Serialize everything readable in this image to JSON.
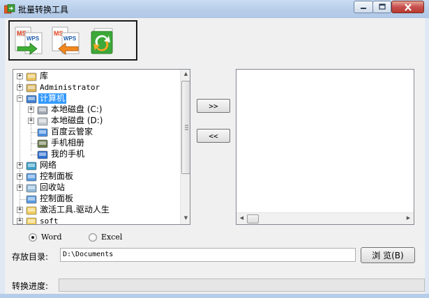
{
  "window": {
    "title": "批量转换工具",
    "controls": {
      "minimize": "–",
      "maximize": "□",
      "close": "✕"
    }
  },
  "toolbar": {
    "buttons": [
      {
        "name": "ms-to-wps",
        "label_top": "MS",
        "label_bottom": "WPS"
      },
      {
        "name": "wps-to-ms",
        "label_top": "MS",
        "label_bottom": "WPS"
      },
      {
        "name": "refresh"
      }
    ]
  },
  "tree": {
    "items": [
      {
        "label": "库",
        "icon": "library-icon",
        "expander": "+"
      },
      {
        "label": "Administrator",
        "icon": "user-folder-icon",
        "expander": "+"
      },
      {
        "label": "计算机",
        "icon": "computer-icon",
        "expander": "−",
        "selected": true
      },
      {
        "label": "本地磁盘 (C:)",
        "icon": "drive-c-icon",
        "expander": "+"
      },
      {
        "label": "本地磁盘 (D:)",
        "icon": "drive-d-icon",
        "expander": "+"
      },
      {
        "label": "百度云管家",
        "icon": "cloud-icon"
      },
      {
        "label": "手机相册",
        "icon": "phone-album-icon"
      },
      {
        "label": "我的手机",
        "icon": "phone-icon"
      },
      {
        "label": "网络",
        "icon": "network-icon",
        "expander": "+"
      },
      {
        "label": "控制面板",
        "icon": "control-panel-icon",
        "expander": "+"
      },
      {
        "label": "回收站",
        "icon": "recycle-bin-icon",
        "expander": "+"
      },
      {
        "label": "控制面板",
        "icon": "control-panel-icon"
      },
      {
        "label": "激活工具.驱动人生",
        "icon": "folder-icon",
        "expander": "+"
      },
      {
        "label": "soft",
        "icon": "folder-icon",
        "expander": "+"
      }
    ]
  },
  "transfer": {
    "add_label": ">>",
    "remove_label": "<<"
  },
  "format": {
    "options": [
      "Word",
      "Excel"
    ],
    "selected": "Word"
  },
  "output": {
    "label": "存放目录:",
    "value": "D:\\Documents",
    "browse_label": "浏 览(B)"
  },
  "progress": {
    "label": "转换进度:",
    "value": 0
  }
}
